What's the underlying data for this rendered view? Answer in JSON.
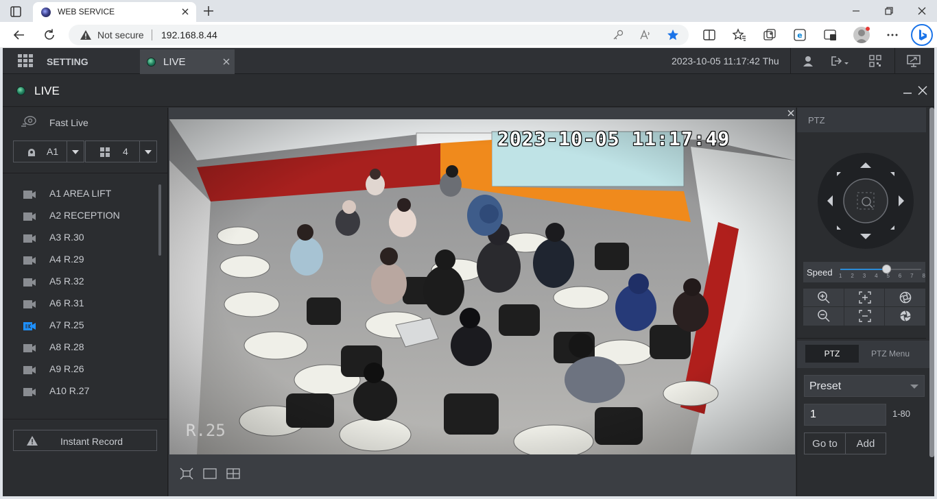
{
  "browser": {
    "tab_title": "WEB SERVICE",
    "security_label": "Not secure",
    "url": "192.168.8.44"
  },
  "app": {
    "nav": {
      "setting_label": "SETTING",
      "live_tab_label": "LIVE",
      "datetime": "2023-10-05 11:17:42 Thu"
    },
    "live_header": {
      "title": "LIVE"
    },
    "left_panel": {
      "fast_live_label": "Fast Live",
      "channel_select_value": "A1",
      "layout_select_value": "4",
      "cameras": [
        {
          "label": "A1 AREA LIFT",
          "active": false
        },
        {
          "label": "A2 RECEPTION",
          "active": false
        },
        {
          "label": "A3 R.30",
          "active": false
        },
        {
          "label": "A4 R.29",
          "active": false
        },
        {
          "label": "A5 R.32",
          "active": false
        },
        {
          "label": "A6 R.31",
          "active": false
        },
        {
          "label": "A7 R.25",
          "active": true
        },
        {
          "label": "A8 R.28",
          "active": false
        },
        {
          "label": "A9 R.26",
          "active": false
        },
        {
          "label": "A10 R.27",
          "active": false
        }
      ],
      "instant_record_label": "Instant Record"
    },
    "video": {
      "osd_timestamp": "2023-10-05 11:17:49",
      "osd_channel": "R.25"
    },
    "ptz": {
      "header_label": "PTZ",
      "speed_label": "Speed",
      "speed_value": 5,
      "speed_ticks": [
        "1",
        "2",
        "3",
        "4",
        "5",
        "6",
        "7",
        "8"
      ],
      "tabs": [
        "PTZ",
        "PTZ Menu"
      ],
      "preset_select_value": "Preset",
      "preset_input_value": "1",
      "preset_range": "1-80",
      "goto_label": "Go to",
      "add_label": "Add"
    },
    "colors": {
      "accent_blue": "#2a8bd8",
      "active_camera_icon": "#1e90ff"
    }
  }
}
